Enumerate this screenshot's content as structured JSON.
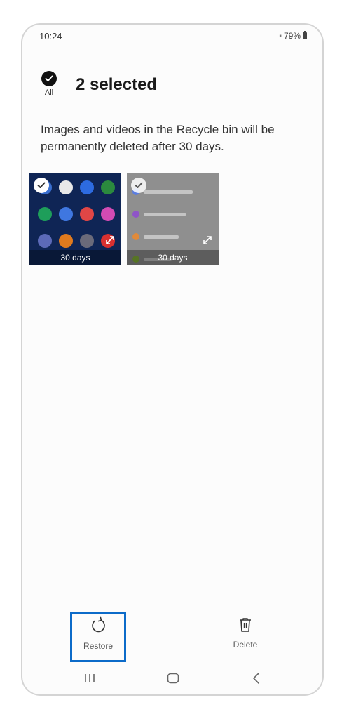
{
  "status": {
    "time": "10:24",
    "battery": "79%"
  },
  "header": {
    "all_label": "All",
    "title": "2 selected"
  },
  "info_text": "Images and videos in the Recycle bin will be permanently deleted after 30 days.",
  "items": [
    {
      "days": "30 days",
      "kind": "app-screen-thumbnail"
    },
    {
      "days": "30 days",
      "kind": "settings-screen-thumbnail"
    }
  ],
  "actions": {
    "restore_label": "Restore",
    "delete_label": "Delete"
  },
  "colors": {
    "highlight": "#0c6bc9"
  },
  "icons": [
    "check-icon",
    "restore-icon",
    "trash-icon",
    "recents-icon",
    "home-icon",
    "back-icon",
    "expand-icon"
  ]
}
